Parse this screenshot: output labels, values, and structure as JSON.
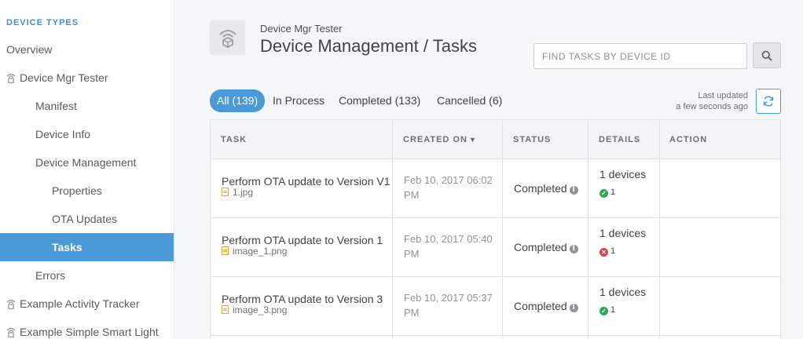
{
  "sidebar": {
    "heading": "DEVICE TYPES",
    "items": [
      {
        "label": "Overview"
      },
      {
        "label": "Device Mgr Tester",
        "icon": "wireless-device-icon"
      },
      {
        "label": "Manifest"
      },
      {
        "label": "Device Info"
      },
      {
        "label": "Device Management"
      },
      {
        "label": "Properties"
      },
      {
        "label": "OTA Updates"
      },
      {
        "label": "Tasks",
        "active": true
      },
      {
        "label": "Errors"
      },
      {
        "label": "Example Activity Tracker",
        "icon": "wireless-device-icon"
      },
      {
        "label": "Example Simple Smart Light",
        "icon": "wireless-device-icon"
      }
    ]
  },
  "header": {
    "device_name": "Device Mgr Tester",
    "title": "Device Management / Tasks",
    "search_placeholder": "FIND TASKS BY DEVICE ID",
    "search_value": ""
  },
  "tabs": [
    {
      "label": "All (139)",
      "active": true
    },
    {
      "label": "In Process"
    },
    {
      "label": "Completed (133)"
    },
    {
      "label": "Cancelled (6)"
    }
  ],
  "last_updated": {
    "line1": "Last updated",
    "line2": "a few seconds ago"
  },
  "table": {
    "columns": [
      "TASK",
      "CREATED ON",
      "STATUS",
      "DETAILS",
      "ACTION"
    ],
    "sort_indicator": "▾",
    "rows": [
      {
        "task": "Perform OTA update to Version V1",
        "file": "1.jpg",
        "created_line1": "Feb 10, 2017 06:02",
        "created_line2": "PM",
        "status": "Completed",
        "details": "1 devices",
        "result_icon": "check-circle-icon",
        "result_count": "1"
      },
      {
        "task": "Perform OTA update to Version 1",
        "file": "image_1.png",
        "created_line1": "Feb 10, 2017 05:40",
        "created_line2": "PM",
        "status": "Completed",
        "details": "1 devices",
        "result_icon": "error-circle-icon",
        "result_count": "1"
      },
      {
        "task": "Perform OTA update to Version 3",
        "file": "image_3.png",
        "created_line1": "Feb 10, 2017 05:37",
        "created_line2": "PM",
        "status": "Completed",
        "details": "1 devices",
        "result_icon": "check-circle-icon",
        "result_count": "1"
      }
    ]
  },
  "colors": {
    "accent": "#4a9ad9",
    "success": "#2fa84f",
    "error": "#d9414b",
    "file_icon": "#e8a23b"
  }
}
